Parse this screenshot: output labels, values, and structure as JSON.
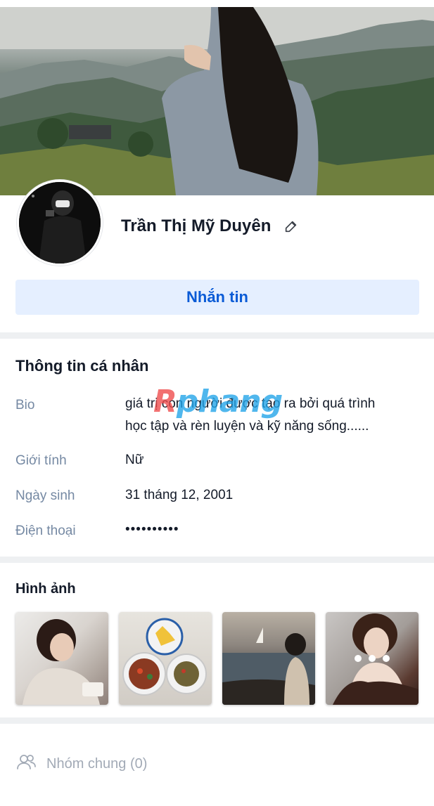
{
  "profile": {
    "name": "Trần Thị Mỹ Duyên",
    "message_button": "Nhắn tin"
  },
  "personal_info": {
    "title": "Thông tin cá nhân",
    "bio_label": "Bio",
    "bio_line1": "giá trị con người được tạo ra bởi quá trình",
    "bio_line2": "học tập và rèn luyện và kỹ năng sống......",
    "gender_label": "Giới tính",
    "gender_value": "Nữ",
    "birthday_label": "Ngày sinh",
    "birthday_value": "31 tháng 12, 2001",
    "phone_label": "Điện thoại",
    "phone_value": "••••••••••"
  },
  "watermark": {
    "part1": "R",
    "part2": "phang"
  },
  "photos": {
    "title": "Hình ảnh",
    "count": 4,
    "has_more_overlay": true
  },
  "groups": {
    "label": "Nhóm chung (0)"
  },
  "colors": {
    "accent": "#0a5bd6",
    "button_bg": "#e5efff",
    "label_gray": "#7589a3",
    "text": "#141b29",
    "divider": "#eef0f2"
  },
  "icons": [
    "pencil-icon",
    "group-icon",
    "more-dots-icon"
  ]
}
